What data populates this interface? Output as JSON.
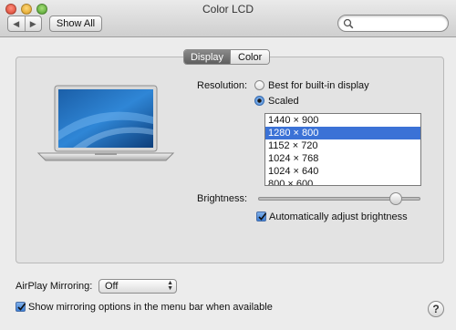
{
  "window": {
    "title": "Color LCD"
  },
  "toolbar": {
    "back_glyph": "◀",
    "forward_glyph": "▶",
    "show_all_label": "Show All",
    "search_placeholder": ""
  },
  "tabs": [
    {
      "label": "Display",
      "active": true
    },
    {
      "label": "Color",
      "active": false
    }
  ],
  "display": {
    "resolution_label": "Resolution:",
    "option_best": "Best for built-in display",
    "option_scaled": "Scaled",
    "selected_option": "Scaled",
    "resolutions": [
      "1440 × 900",
      "1280 × 800",
      "1152 × 720",
      "1024 × 768",
      "1024 × 640",
      "800 × 600"
    ],
    "selected_resolution": "1280 × 800",
    "brightness_label": "Brightness:",
    "brightness_level": 0.87,
    "auto_brightness_label": "Automatically adjust brightness",
    "auto_brightness_checked": true
  },
  "airplay": {
    "label": "AirPlay Mirroring:",
    "value": "Off",
    "show_options_label": "Show mirroring options in the menu bar when available",
    "show_options_checked": true
  },
  "help": {
    "glyph": "?"
  },
  "colors": {
    "selection": "#3b72d6",
    "accent": "#3d7fd6"
  }
}
